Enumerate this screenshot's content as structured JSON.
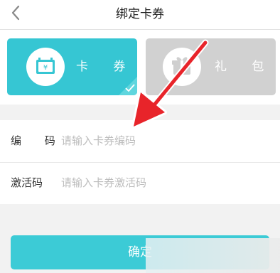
{
  "header": {
    "title": "绑定卡券",
    "back_icon": "chevron-left-icon"
  },
  "tabs": [
    {
      "label": "卡 券",
      "icon": "coupon-icon",
      "selected": true,
      "color": "#36c6d3"
    },
    {
      "label": "礼 包",
      "icon": "gift-icon",
      "selected": false,
      "color": "#d1d1d1"
    }
  ],
  "form": {
    "code": {
      "label": "编 码",
      "placeholder": "请输入卡券编码",
      "value": ""
    },
    "activation": {
      "label": "激活码",
      "placeholder": "请输入卡券激活码",
      "value": ""
    }
  },
  "confirm_button": {
    "label": "确定"
  },
  "annotation": {
    "arrow_color": "#e8242a"
  }
}
